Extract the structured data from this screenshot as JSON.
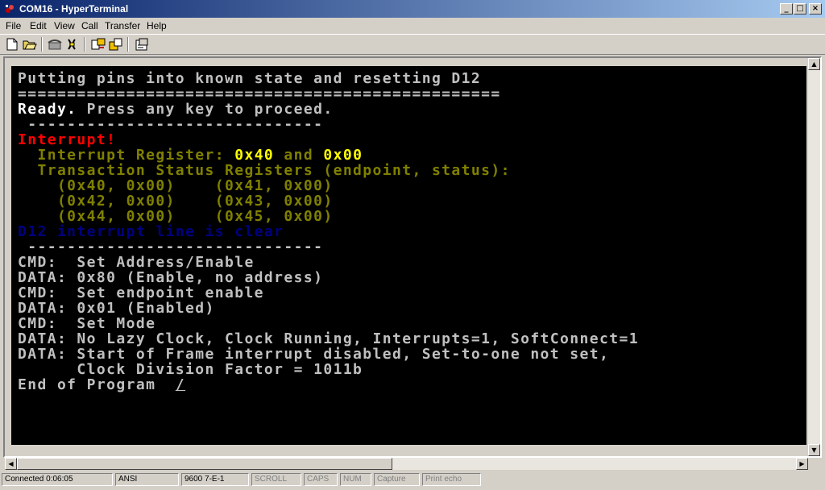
{
  "window": {
    "title": "COM16 - HyperTerminal",
    "controls": {
      "minimize": "_",
      "maximize": "□",
      "close": "×"
    }
  },
  "menu": [
    "File",
    "Edit",
    "View",
    "Call",
    "Transfer",
    "Help"
  ],
  "toolbar": {
    "icons": [
      "new-icon",
      "open-icon",
      "phone-icon",
      "disconnect-icon",
      "send-icon",
      "receive-icon",
      "properties-icon"
    ]
  },
  "terminal": {
    "lines": [
      {
        "text": "Putting pins into known state and resetting D12",
        "color": "#c0c0c0"
      },
      {
        "text": "=================================================",
        "color": "#c0c0c0"
      },
      {
        "text": "Ready. Press any key to proceed.",
        "color": "#ffffff",
        "segments": [
          {
            "t": "Ready.",
            "c": "#ffffff"
          },
          {
            "t": " Press any key to proceed.",
            "c": "#c0c0c0"
          }
        ]
      },
      {
        "text": " ------------------------------",
        "color": "#c0c0c0"
      },
      {
        "text": "Interrupt!",
        "color": "#ff0000"
      },
      {
        "text": "  Interrupt Register: 0x40 and 0x00",
        "color": "#808000",
        "segments": [
          {
            "t": "  Interrupt Register: ",
            "c": "#808000"
          },
          {
            "t": "0x40",
            "c": "#ffff00"
          },
          {
            "t": " and ",
            "c": "#808000"
          },
          {
            "t": "0x00",
            "c": "#ffff00"
          }
        ]
      },
      {
        "text": "  Transaction Status Registers (endpoint, status):",
        "color": "#808000"
      },
      {
        "text": "    (0x40, 0x00)    (0x41, 0x00)",
        "color": "#808000"
      },
      {
        "text": "    (0x42, 0x00)    (0x43, 0x00)",
        "color": "#808000"
      },
      {
        "text": "    (0x44, 0x00)    (0x45, 0x00)",
        "color": "#808000"
      },
      {
        "text": "D12 interrupt line is clear",
        "color": "#000080"
      },
      {
        "text": " ------------------------------",
        "color": "#c0c0c0"
      },
      {
        "text": "CMD:  Set Address/Enable",
        "color": "#c0c0c0"
      },
      {
        "text": "DATA: 0x80 (Enable, no address)",
        "color": "#c0c0c0"
      },
      {
        "text": "CMD:  Set endpoint enable",
        "color": "#c0c0c0"
      },
      {
        "text": "DATA: 0x01 (Enabled)",
        "color": "#c0c0c0"
      },
      {
        "text": "CMD:  Set Mode",
        "color": "#c0c0c0"
      },
      {
        "text": "DATA: No Lazy Clock, Clock Running, Interrupts=1, SoftConnect=1",
        "color": "#c0c0c0"
      },
      {
        "text": "DATA: Start of Frame interrupt disabled, Set-to-one not set,",
        "color": "#c0c0c0"
      },
      {
        "text": "      Clock Division Factor = 1011b",
        "color": "#c0c0c0"
      },
      {
        "text": "End of Program  ",
        "color": "#c0c0c0",
        "cursor": "/"
      }
    ]
  },
  "status": [
    {
      "text": "Connected 0:06:05",
      "active": true
    },
    {
      "text": "ANSI",
      "active": true
    },
    {
      "text": "9600 7-E-1",
      "active": true
    },
    {
      "text": "SCROLL",
      "active": false
    },
    {
      "text": "CAPS",
      "active": false
    },
    {
      "text": "NUM",
      "active": false
    },
    {
      "text": "Capture",
      "active": false
    },
    {
      "text": "Print echo",
      "active": false
    }
  ]
}
